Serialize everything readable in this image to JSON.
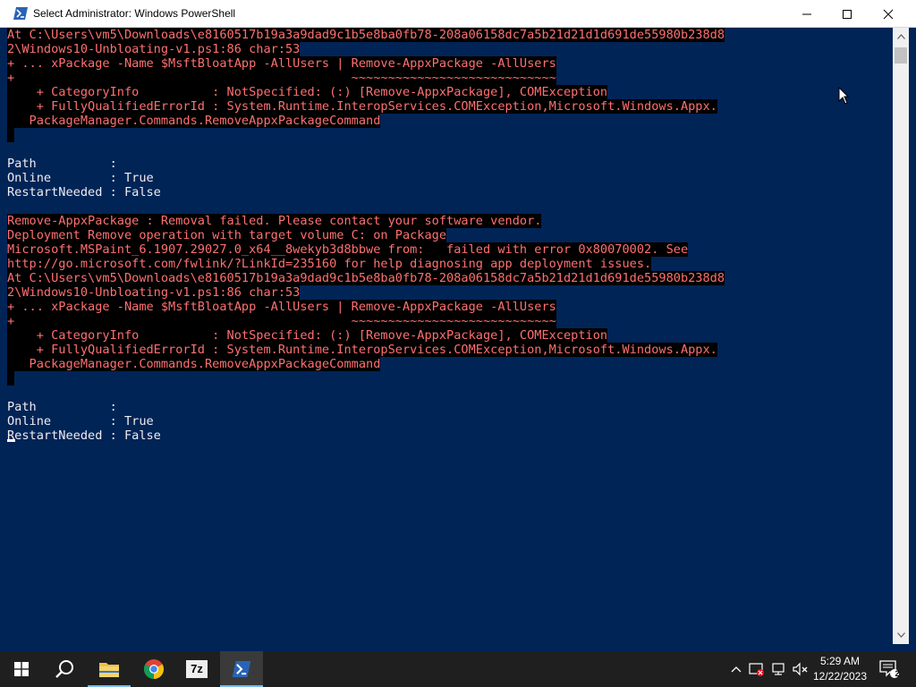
{
  "window": {
    "title": "Select Administrator: Windows PowerShell"
  },
  "console": {
    "lines": [
      {
        "text": "At C:\\Users\\vm5\\Downloads\\e8160517b19a3a9dad9c1b5e8ba0fb78-208a06158dc7a5b21d21d1d691de55980b238d8",
        "type": "err"
      },
      {
        "text": "2\\Windows10-Unbloating-v1.ps1:86 char:53",
        "type": "err"
      },
      {
        "text": "+ ... xPackage -Name $MsftBloatApp -AllUsers | Remove-AppxPackage -AllUsers",
        "type": "err"
      },
      {
        "text": "+                                              ~~~~~~~~~~~~~~~~~~~~~~~~~~~~",
        "type": "err"
      },
      {
        "text": "    + CategoryInfo          : NotSpecified: (:) [Remove-AppxPackage], COMException",
        "type": "err"
      },
      {
        "text": "    + FullyQualifiedErrorId : System.Runtime.InteropServices.COMException,Microsoft.Windows.Appx.",
        "type": "err"
      },
      {
        "text": "   PackageManager.Commands.RemoveAppxPackageCommand",
        "type": "err"
      },
      {
        "text": " ",
        "type": "err"
      },
      {
        "text": "",
        "type": "out"
      },
      {
        "text": "Path          :",
        "type": "out"
      },
      {
        "text": "Online        : True",
        "type": "out"
      },
      {
        "text": "RestartNeeded : False",
        "type": "out"
      },
      {
        "text": "",
        "type": "out"
      },
      {
        "text": "Remove-AppxPackage : Removal failed. Please contact your software vendor.",
        "type": "err"
      },
      {
        "text": "Deployment Remove operation with target volume C: on Package",
        "type": "err"
      },
      {
        "text": "Microsoft.MSPaint_6.1907.29027.0_x64__8wekyb3d8bbwe from:   failed with error 0x80070002. See",
        "type": "err"
      },
      {
        "text": "http://go.microsoft.com/fwlink/?LinkId=235160 for help diagnosing app deployment issues.",
        "type": "err"
      },
      {
        "text": "At C:\\Users\\vm5\\Downloads\\e8160517b19a3a9dad9c1b5e8ba0fb78-208a06158dc7a5b21d21d1d691de55980b238d8",
        "type": "err"
      },
      {
        "text": "2\\Windows10-Unbloating-v1.ps1:86 char:53",
        "type": "err"
      },
      {
        "text": "+ ... xPackage -Name $MsftBloatApp -AllUsers | Remove-AppxPackage -AllUsers",
        "type": "err"
      },
      {
        "text": "+                                              ~~~~~~~~~~~~~~~~~~~~~~~~~~~~",
        "type": "err"
      },
      {
        "text": "    + CategoryInfo          : NotSpecified: (:) [Remove-AppxPackage], COMException",
        "type": "err"
      },
      {
        "text": "    + FullyQualifiedErrorId : System.Runtime.InteropServices.COMException,Microsoft.Windows.Appx.",
        "type": "err"
      },
      {
        "text": "   PackageManager.Commands.RemoveAppxPackageCommand",
        "type": "err"
      },
      {
        "text": " ",
        "type": "err"
      },
      {
        "text": "",
        "type": "out"
      },
      {
        "text": "Path          :",
        "type": "out"
      },
      {
        "text": "Online        : True",
        "type": "out"
      },
      {
        "text": "RestartNeeded : False",
        "type": "out"
      }
    ]
  },
  "taskbar": {
    "apps": [
      {
        "name": "start-button",
        "icon": "windows-logo-icon"
      },
      {
        "name": "search-button",
        "icon": "search-icon"
      },
      {
        "name": "file-explorer",
        "icon": "folder-icon"
      },
      {
        "name": "chrome",
        "icon": "chrome-icon"
      },
      {
        "name": "7zip",
        "icon": "7zip-icon",
        "label": "7z"
      },
      {
        "name": "powershell",
        "icon": "powershell-icon",
        "active": true
      }
    ],
    "clock": {
      "time": "5:29 AM",
      "date": "12/22/2023"
    },
    "notifications": {
      "count": "2"
    }
  },
  "colors": {
    "console_bg": "#012456",
    "error_fg": "#ff7070",
    "error_bg": "#000000",
    "output_fg": "#eeedf0",
    "taskbar_bg": "#1f1f1f",
    "accent": "#76b9ed"
  }
}
